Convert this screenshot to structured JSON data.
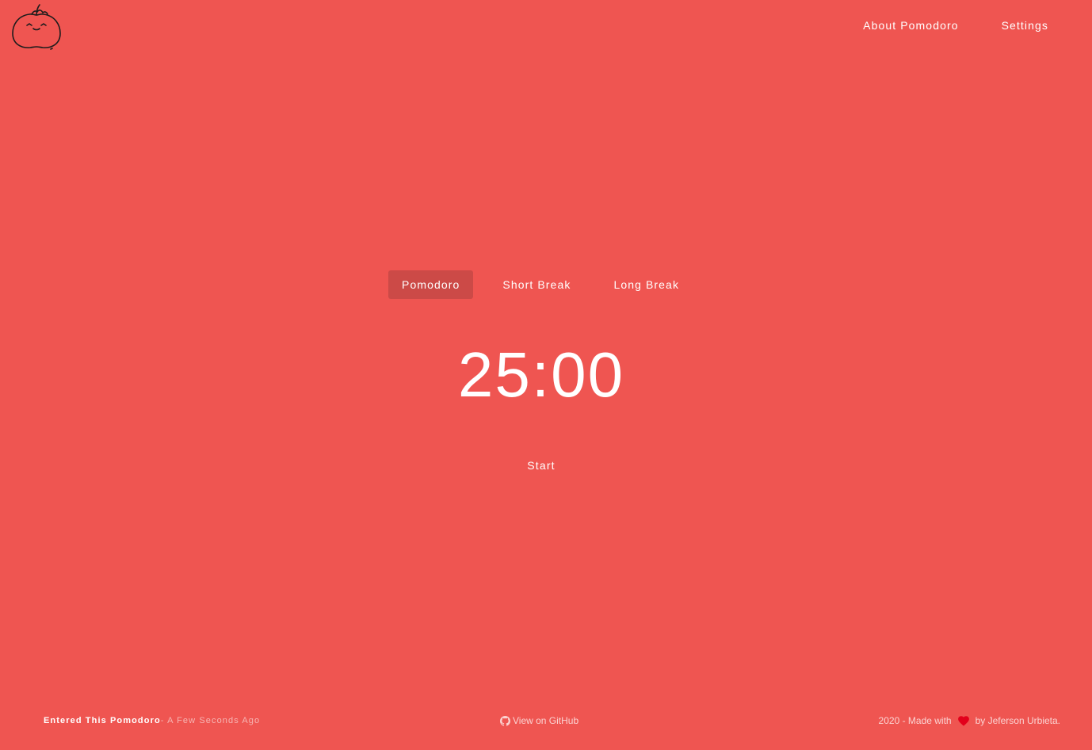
{
  "header": {
    "logo_icon": "tomato-face-icon",
    "nav": [
      {
        "label": "About Pomodoro"
      },
      {
        "label": "Settings"
      }
    ]
  },
  "main": {
    "tabs": [
      {
        "label": "Pomodoro",
        "active": true
      },
      {
        "label": "Short Break",
        "active": false
      },
      {
        "label": "Long Break",
        "active": false
      }
    ],
    "timer": "25:00",
    "start_label": "Start"
  },
  "footer": {
    "entered_label": "Entered This Pomodoro",
    "entered_time": "- A Few Seconds Ago",
    "github_icon": "github-icon",
    "github_label": "View on GitHub",
    "made_prefix": "2020 - Made with",
    "heart_icon": "heart-icon",
    "made_suffix": "by Jeferson Urbieta."
  },
  "colors": {
    "background": "#ef5551",
    "active_tab": "#cc4a47",
    "heart": "#e3001b"
  }
}
